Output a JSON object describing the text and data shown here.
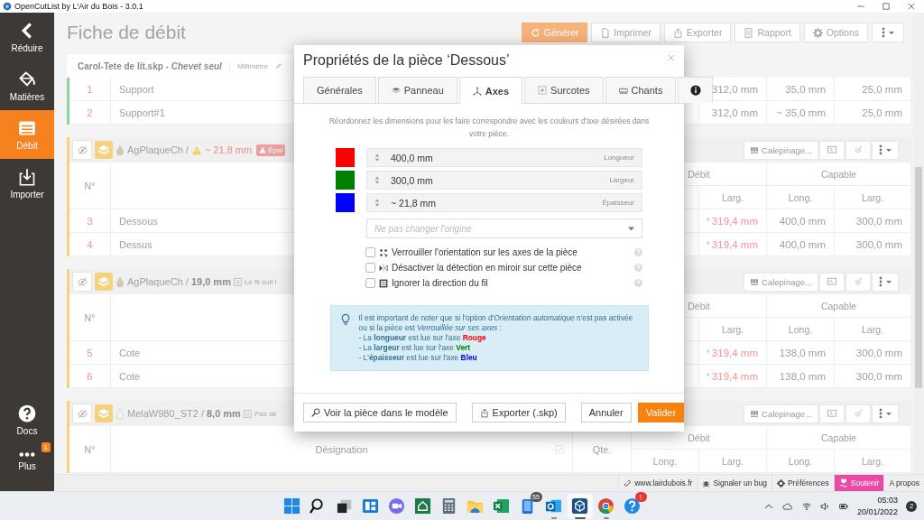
{
  "window": {
    "title": "OpenCutList by L'Air du Bois - 3.0.1"
  },
  "sidebar": {
    "items": [
      {
        "label": "Réduire",
        "kind": "back",
        "selected": false
      },
      {
        "label": "Matières",
        "kind": "materials",
        "selected": false
      },
      {
        "label": "Débit",
        "kind": "cutlist",
        "selected": true
      },
      {
        "label": "Importer",
        "kind": "import",
        "selected": false
      }
    ],
    "bottom_items": [
      {
        "label": "Docs",
        "kind": "help"
      },
      {
        "label": "Plus",
        "kind": "more",
        "badge": "1"
      }
    ]
  },
  "page": {
    "title": "Fiche de débit",
    "toolbar": [
      {
        "label": "Générer",
        "kind": "refresh",
        "primary": true
      },
      {
        "label": "Imprimer",
        "kind": "print",
        "primary": false
      },
      {
        "label": "Exporter",
        "kind": "export",
        "primary": false
      },
      {
        "label": "Rapport",
        "kind": "report",
        "primary": false
      },
      {
        "label": "Options",
        "kind": "options",
        "primary": false
      },
      {
        "kind": "menu",
        "primary": false
      }
    ],
    "file_tab": {
      "title": "Carol-Tete de lit.skp - *Chevet seul*",
      "unit": "Millimètre"
    },
    "groups": [
      {
        "color": "#8fd5a0",
        "rows": [
          {
            "number": "1",
            "name": "Support",
            "values": [
              {
                "text": "312,0 mm",
                "kind": "plain"
              },
              {
                "text": "35,0 mm",
                "kind": "plain"
              },
              {
                "text": "25,0 mm",
                "kind": "plain"
              }
            ]
          },
          {
            "number": "2",
            "name": "Support#1",
            "values": [
              {
                "text": "312,0 mm",
                "kind": "plain"
              },
              {
                "text": "~ 35,0 mm",
                "kind": "plain"
              },
              {
                "text": "25,0 mm",
                "kind": "plain"
              }
            ]
          }
        ]
      },
      {
        "color": "#f6d27f",
        "header": {
          "material": "AgPlaqueCh /",
          "color": "#d8c7a6",
          "thickness": "~ 21,8 mm",
          "kind": "warning",
          "tag": {
            "kind": "warning",
            "text": "Épai"
          },
          "action": "Calepinage..."
        },
        "columns": {
          "number": "N°",
          "cut": "Débit",
          "cut_width": "Larg.",
          "final": "Capable",
          "final_length": "Long.",
          "final_width": "Larg."
        },
        "rows": [
          {
            "number": "3",
            "name": "Dessous",
            "values": [
              {
                "text": "319,4 mm",
                "kind": "override",
                "mark": "*"
              },
              {
                "text": "400,0 mm",
                "kind": "plain"
              },
              {
                "text": "300,0 mm",
                "kind": "plain"
              }
            ]
          },
          {
            "number": "4",
            "name": "Dessus",
            "values": [
              {
                "text": "319,4 mm",
                "kind": "override",
                "mark": "*"
              },
              {
                "text": "400,0 mm",
                "kind": "plain"
              },
              {
                "text": "300,0 mm",
                "kind": "plain"
              }
            ]
          }
        ]
      },
      {
        "color": "#f6d27f",
        "header": {
          "material": "AgPlaqueCh /",
          "color": "#d8c7a6",
          "thickness": "19,0 mm",
          "kind": "normal",
          "tag": {
            "kind": "grain",
            "text": "Le fil suit l"
          },
          "action": "Calepinage..."
        },
        "columns": {
          "number": "N°",
          "cut": "Débit",
          "cut_width": "Larg.",
          "final": "Capable",
          "final_length": "Long.",
          "final_width": "Larg."
        },
        "rows": [
          {
            "number": "5",
            "name": "Cote",
            "values": [
              {
                "text": "319,4 mm",
                "kind": "override",
                "mark": "*"
              },
              {
                "text": "138,0 mm",
                "kind": "plain"
              },
              {
                "text": "300,0 mm",
                "kind": "plain"
              }
            ]
          },
          {
            "number": "6",
            "name": "Cote",
            "values": [
              {
                "text": "319,4 mm",
                "kind": "override",
                "mark": "*"
              },
              {
                "text": "138,0 mm",
                "kind": "plain"
              },
              {
                "text": "300,0 mm",
                "kind": "plain"
              }
            ]
          }
        ]
      },
      {
        "color": "#f6d27f",
        "header": {
          "material": "MelaW980_ST2 /",
          "color": "#f2f2f2",
          "thickness": "8,0 mm",
          "kind": "normal",
          "tag": {
            "kind": "grain",
            "text": "Pas de"
          },
          "action": "Calepinage..."
        },
        "columns": {
          "number": "N°",
          "designation": "Désignation",
          "quantity": "Qte.",
          "cut": "Débit",
          "cut_length": "Long.",
          "cut_width": "Larg.",
          "final": "Capable",
          "final_length": "Long.",
          "final_width": "Larg."
        }
      }
    ]
  },
  "dialog": {
    "title": "Propriétés de la pièce ‘Dessous’",
    "tabs": [
      {
        "label": "Générales",
        "kind": "text",
        "selected": false
      },
      {
        "label": "Panneau",
        "kind": "panel",
        "selected": false
      },
      {
        "label": "Axes",
        "kind": "axes",
        "selected": true
      },
      {
        "label": "Surcotes",
        "kind": "oversize",
        "selected": false
      },
      {
        "label": "Chants",
        "kind": "edges",
        "selected": false
      },
      {
        "kind": "info",
        "selected": false
      }
    ],
    "intro": "Réordonnez les dimensions pour les faire correspondre avec les couleurs d'axe désirées dans votre pièce.",
    "axes": [
      {
        "color": "#ff0000",
        "value": "400,0 mm",
        "label": "Longueur"
      },
      {
        "color": "#008000",
        "value": "300,0 mm",
        "label": "Largeur"
      },
      {
        "color": "#0000ff",
        "value": "~ 21,8 mm",
        "label": "Épaisseur"
      }
    ],
    "origin_select": {
      "placeholder": "Ne pas changer l'origine"
    },
    "options": [
      {
        "label": "Verrouiller l'orientation sur les axes de la pièce",
        "kind": "lock",
        "checked": false
      },
      {
        "label": "Désactiver la détection en miroir sur cette pièce",
        "kind": "mirror",
        "checked": false
      },
      {
        "label": "Ignorer la direction du fil",
        "kind": "grain",
        "checked": false
      }
    ],
    "note": {
      "text": "Il est important de noter que si l'option d'*Orientation automatique* n'est pas activée ou si la pièce est *Verrouillée sur ses axes* :",
      "lines": [
        {
          "text": "- La **longueur** est lue sur l'axe **Rouge**",
          "color": "#ff0000"
        },
        {
          "text": "- La **largeur** est lue sur l'axe **Vert**",
          "color": "#008000"
        },
        {
          "text": "- L'**épaisseur** est lue sur l'axe **Bleu**",
          "color": "#0000ff"
        }
      ]
    },
    "buttons": [
      {
        "label": "Voir la pièce dans le modèle",
        "kind": "search"
      },
      {
        "label": "Exporter (.skp)",
        "kind": "export"
      },
      {
        "label": "Annuler",
        "kind": "cancel"
      },
      {
        "label": "Valider",
        "kind": "primary"
      }
    ]
  },
  "footer": {
    "links": [
      {
        "label": "www.lairdubois.fr",
        "kind": "link",
        "highlighted": false
      },
      {
        "label": "Signaler un bug",
        "kind": "bug",
        "highlighted": false
      },
      {
        "label": "Préférences",
        "kind": "options",
        "highlighted": false
      },
      {
        "label": "Soutenir",
        "kind": "support",
        "highlighted": true
      },
      {
        "label": "A propos",
        "kind": "about",
        "highlighted": false
      }
    ]
  },
  "taskbar": {
    "apps": [
      {
        "kind": "start",
        "running": false,
        "active": false
      },
      {
        "kind": "search",
        "running": false,
        "active": false
      },
      {
        "kind": "task_view",
        "running": false,
        "active": false
      },
      {
        "kind": "widgets",
        "running": false,
        "active": false
      },
      {
        "kind": "chat",
        "running": false,
        "active": false
      },
      {
        "kind": "house",
        "running": false,
        "active": false
      },
      {
        "kind": "calculator",
        "running": false,
        "active": false
      },
      {
        "kind": "folder",
        "running": false,
        "active": false
      },
      {
        "kind": "spreadsheet",
        "running": false,
        "active": false
      },
      {
        "kind": "phone",
        "running": false,
        "active": false,
        "badge": "55"
      },
      {
        "kind": "mail",
        "running": true,
        "active": false
      },
      {
        "kind": "cube",
        "running": true,
        "active": true
      },
      {
        "kind": "browser",
        "running": true,
        "active": false
      },
      {
        "kind": "help",
        "running": false,
        "active": false,
        "badge": "!"
      }
    ],
    "tray": {
      "time": "05:03",
      "date": "20/01/2022",
      "notifications": "2"
    }
  }
}
